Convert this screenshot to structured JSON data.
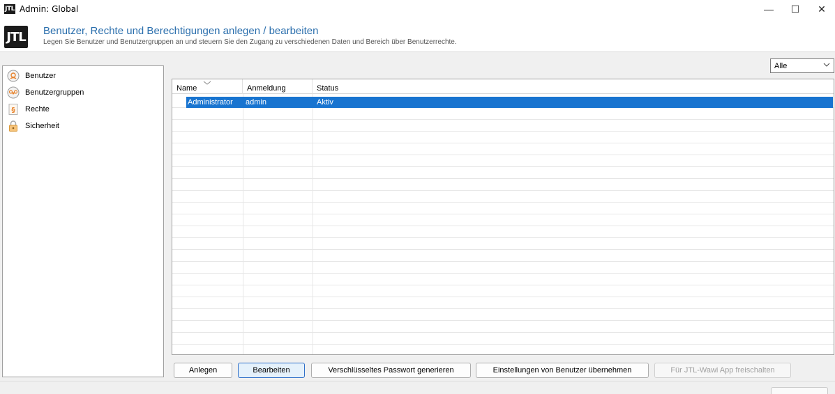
{
  "window": {
    "app_icon_text": "JTL",
    "title": "Admin: Global",
    "minimize_glyph": "—",
    "maximize_glyph": "☐",
    "close_glyph": "✕"
  },
  "header": {
    "logo_text": "JTL",
    "title": "Benutzer, Rechte und Berechtigungen anlegen / bearbeiten",
    "subtitle": "Legen Sie Benutzer und Benutzergruppen an und steuern Sie den Zugang zu verschiedenen Daten und Bereich über Benutzerrechte."
  },
  "sidebar": {
    "items": [
      {
        "label": "Benutzer",
        "icon": "user-icon"
      },
      {
        "label": "Benutzergruppen",
        "icon": "user-group-icon"
      },
      {
        "label": "Rechte",
        "icon": "rights-document-icon"
      },
      {
        "label": "Sicherheit",
        "icon": "lock-icon"
      }
    ]
  },
  "filter": {
    "selected": "Alle"
  },
  "table": {
    "columns": [
      "Name",
      "Anmeldung",
      "Status"
    ],
    "rows": [
      {
        "name": "Administrator",
        "login": "admin",
        "status": "Aktiv"
      }
    ]
  },
  "buttons": {
    "anlegen": "Anlegen",
    "bearbeiten": "Bearbeiten",
    "passwort": "Verschlüsseltes Passwort generieren",
    "einstellungen": "Einstellungen von Benutzer übernehmen",
    "app": "Für JTL-Wawi App freischalten"
  },
  "colors": {
    "accent": "#1874d0",
    "header_title": "#2b6fad",
    "icon_orange": "#e8822a"
  }
}
